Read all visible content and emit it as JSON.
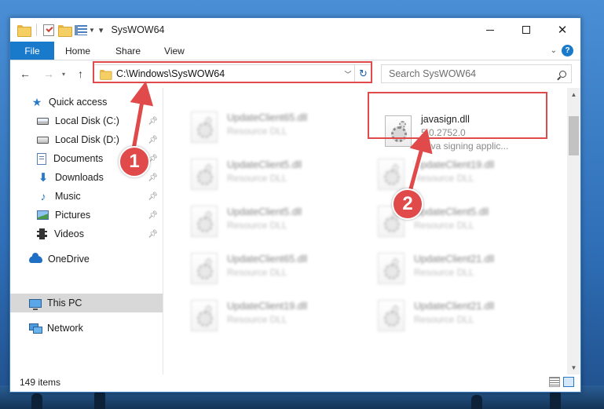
{
  "window": {
    "title": "SysWOW64"
  },
  "ribbon": {
    "tabs": [
      "File",
      "Home",
      "Share",
      "View"
    ]
  },
  "address": {
    "path": "C:\\Windows\\SysWOW64"
  },
  "search": {
    "placeholder": "Search SysWOW64"
  },
  "nav_pane": {
    "items": [
      {
        "label": "Quick access",
        "icon": "star-icon",
        "pinned": false
      },
      {
        "label": "Local Disk (C:)",
        "icon": "disk-icon",
        "pinned": true
      },
      {
        "label": "Local Disk (D:)",
        "icon": "disk-icon",
        "pinned": true
      },
      {
        "label": "Documents",
        "icon": "documents-icon",
        "pinned": true
      },
      {
        "label": "Downloads",
        "icon": "download-icon",
        "pinned": true
      },
      {
        "label": "Music",
        "icon": "music-icon",
        "pinned": true
      },
      {
        "label": "Pictures",
        "icon": "pictures-icon",
        "pinned": true
      },
      {
        "label": "Videos",
        "icon": "videos-icon",
        "pinned": true
      },
      {
        "label": "OneDrive",
        "icon": "cloud-icon",
        "pinned": false
      },
      {
        "label": "This PC",
        "icon": "pc-icon",
        "pinned": false,
        "selected": true
      },
      {
        "label": "Network",
        "icon": "network-icon",
        "pinned": false
      }
    ]
  },
  "files": {
    "highlighted": {
      "name": "javasign.dll",
      "version": "5.0.2752.0",
      "description": "Java signing applic..."
    },
    "left_column": [
      {
        "name": "UpdateClient65.dll",
        "type": "Resource DLL"
      },
      {
        "name": "UpdateClient5.dll",
        "type": "Resource DLL"
      },
      {
        "name": "UpdateClient5.dll",
        "type": "Resource DLL"
      },
      {
        "name": "UpdateClient65.dll",
        "type": "Resource DLL"
      },
      {
        "name": "UpdateClient19.dll",
        "type": "Resource DLL"
      }
    ],
    "right_column": [
      {
        "name": "UpdateClient19.dll",
        "type": "Resource DLL"
      },
      {
        "name": "UpdateClient5.dll",
        "type": "Resource DLL"
      },
      {
        "name": "UpdateClient21.dll",
        "type": "Resource DLL"
      },
      {
        "name": "UpdateClient21.dll",
        "type": "Resource DLL"
      }
    ]
  },
  "status": {
    "item_count": "149 items"
  },
  "annotations": {
    "step1": "1",
    "step2": "2",
    "color": "#e04a4a"
  }
}
